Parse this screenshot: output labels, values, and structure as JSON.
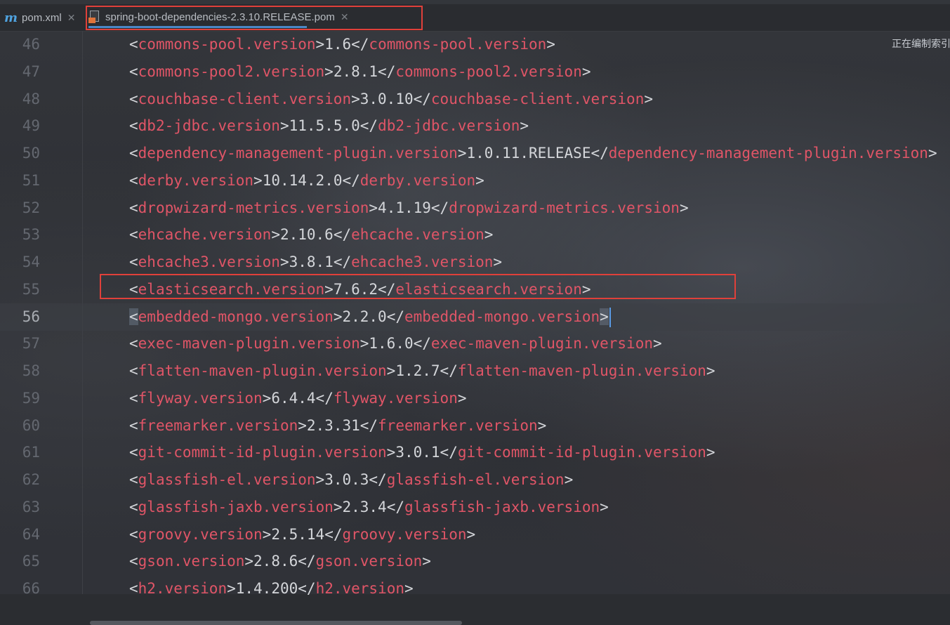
{
  "tabs": [
    {
      "label": "pom.xml",
      "icon": "maven-m-icon",
      "active": false
    },
    {
      "label": "spring-boot-dependencies-2.3.10.RELEASE.pom",
      "icon": "pom-file-icon",
      "active": true
    }
  ],
  "status_text": "正在编制索引",
  "current_line": 56,
  "highlighted_line": 55,
  "colors": {
    "tag": "#e05567",
    "text": "#d4d6da",
    "highlight_box": "#e0403a",
    "line_number": "#646870"
  },
  "lines": [
    {
      "num": "46",
      "tag": "commons-pool.version",
      "value": "1.6"
    },
    {
      "num": "47",
      "tag": "commons-pool2.version",
      "value": "2.8.1"
    },
    {
      "num": "48",
      "tag": "couchbase-client.version",
      "value": "3.0.10"
    },
    {
      "num": "49",
      "tag": "db2-jdbc.version",
      "value": "11.5.5.0"
    },
    {
      "num": "50",
      "tag": "dependency-management-plugin.version",
      "value": "1.0.11.RELEASE"
    },
    {
      "num": "51",
      "tag": "derby.version",
      "value": "10.14.2.0"
    },
    {
      "num": "52",
      "tag": "dropwizard-metrics.version",
      "value": "4.1.19"
    },
    {
      "num": "53",
      "tag": "ehcache.version",
      "value": "2.10.6"
    },
    {
      "num": "54",
      "tag": "ehcache3.version",
      "value": "3.8.1"
    },
    {
      "num": "55",
      "tag": "elasticsearch.version",
      "value": "7.6.2"
    },
    {
      "num": "56",
      "tag": "embedded-mongo.version",
      "value": "2.2.0"
    },
    {
      "num": "57",
      "tag": "exec-maven-plugin.version",
      "value": "1.6.0"
    },
    {
      "num": "58",
      "tag": "flatten-maven-plugin.version",
      "value": "1.2.7"
    },
    {
      "num": "59",
      "tag": "flyway.version",
      "value": "6.4.4"
    },
    {
      "num": "60",
      "tag": "freemarker.version",
      "value": "2.3.31"
    },
    {
      "num": "61",
      "tag": "git-commit-id-plugin.version",
      "value": "3.0.1"
    },
    {
      "num": "62",
      "tag": "glassfish-el.version",
      "value": "3.0.3"
    },
    {
      "num": "63",
      "tag": "glassfish-jaxb.version",
      "value": "2.3.4"
    },
    {
      "num": "64",
      "tag": "groovy.version",
      "value": "2.5.14"
    },
    {
      "num": "65",
      "tag": "gson.version",
      "value": "2.8.6"
    },
    {
      "num": "66",
      "tag": "h2.version",
      "value": "1.4.200"
    }
  ]
}
